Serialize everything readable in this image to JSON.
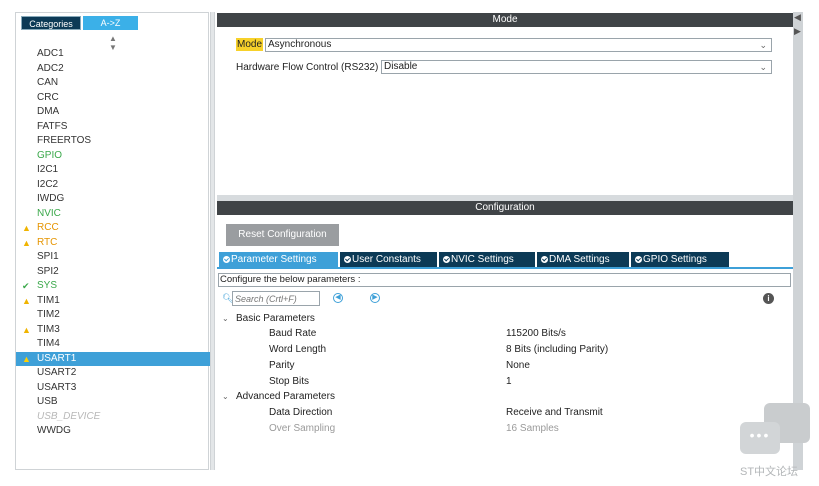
{
  "left_panel": {
    "tabs": [
      "Categories",
      "A->Z"
    ],
    "sort_icon": "sort-arrows-icon",
    "items": [
      {
        "label": "ADC1",
        "state": "normal"
      },
      {
        "label": "ADC2",
        "state": "normal"
      },
      {
        "label": "CAN",
        "state": "normal"
      },
      {
        "label": "CRC",
        "state": "normal"
      },
      {
        "label": "DMA",
        "state": "normal"
      },
      {
        "label": "FATFS",
        "state": "normal"
      },
      {
        "label": "FREERTOS",
        "state": "normal"
      },
      {
        "label": "GPIO",
        "state": "green"
      },
      {
        "label": "I2C1",
        "state": "normal"
      },
      {
        "label": "I2C2",
        "state": "normal"
      },
      {
        "label": "IWDG",
        "state": "normal"
      },
      {
        "label": "NVIC",
        "state": "green"
      },
      {
        "label": "RCC",
        "state": "warning"
      },
      {
        "label": "RTC",
        "state": "warning"
      },
      {
        "label": "SPI1",
        "state": "normal"
      },
      {
        "label": "SPI2",
        "state": "normal"
      },
      {
        "label": "SYS",
        "state": "check"
      },
      {
        "label": "TIM1",
        "state": "warning-dark"
      },
      {
        "label": "TIM2",
        "state": "normal"
      },
      {
        "label": "TIM3",
        "state": "warning-dark"
      },
      {
        "label": "TIM4",
        "state": "normal"
      },
      {
        "label": "USART1",
        "state": "selected"
      },
      {
        "label": "USART2",
        "state": "normal"
      },
      {
        "label": "USART3",
        "state": "normal"
      },
      {
        "label": "USB",
        "state": "normal"
      },
      {
        "label": "USB_DEVICE",
        "state": "disabled"
      },
      {
        "label": "WWDG",
        "state": "normal"
      }
    ]
  },
  "mode": {
    "header": "Mode",
    "mode_label": "Mode",
    "mode_value": "Asynchronous",
    "hfc_label": "Hardware Flow Control (RS232)",
    "hfc_value": "Disable"
  },
  "config": {
    "header": "Configuration",
    "reset_button": "Reset Configuration",
    "tabs": [
      "Parameter Settings",
      "User Constants",
      "NVIC Settings",
      "DMA Settings",
      "GPIO Settings"
    ],
    "active_tab": "Parameter Settings",
    "hint": "Configure the below parameters :",
    "search_placeholder": "Search (Crtl+F)",
    "groups": {
      "basic": {
        "label": "Basic Parameters",
        "rows": [
          {
            "name": "Baud Rate",
            "value": "115200 Bits/s"
          },
          {
            "name": "Word Length",
            "value": "8 Bits (including Parity)"
          },
          {
            "name": "Parity",
            "value": "None"
          },
          {
            "name": "Stop Bits",
            "value": "1"
          }
        ]
      },
      "advanced": {
        "label": "Advanced Parameters",
        "rows": [
          {
            "name": "Data Direction",
            "value": "Receive and Transmit"
          },
          {
            "name": "Over Sampling",
            "value": "16 Samples"
          }
        ]
      }
    }
  },
  "watermark": {
    "text": "ST中文论坛"
  },
  "colors": {
    "header_bg": "#404447",
    "accent_blue": "#3ea0d8",
    "dark_tab": "#0c3a56",
    "mode_highlight": "#f7d12a",
    "ok_green": "#3aa84a",
    "warn_yellow": "#f0b400"
  }
}
